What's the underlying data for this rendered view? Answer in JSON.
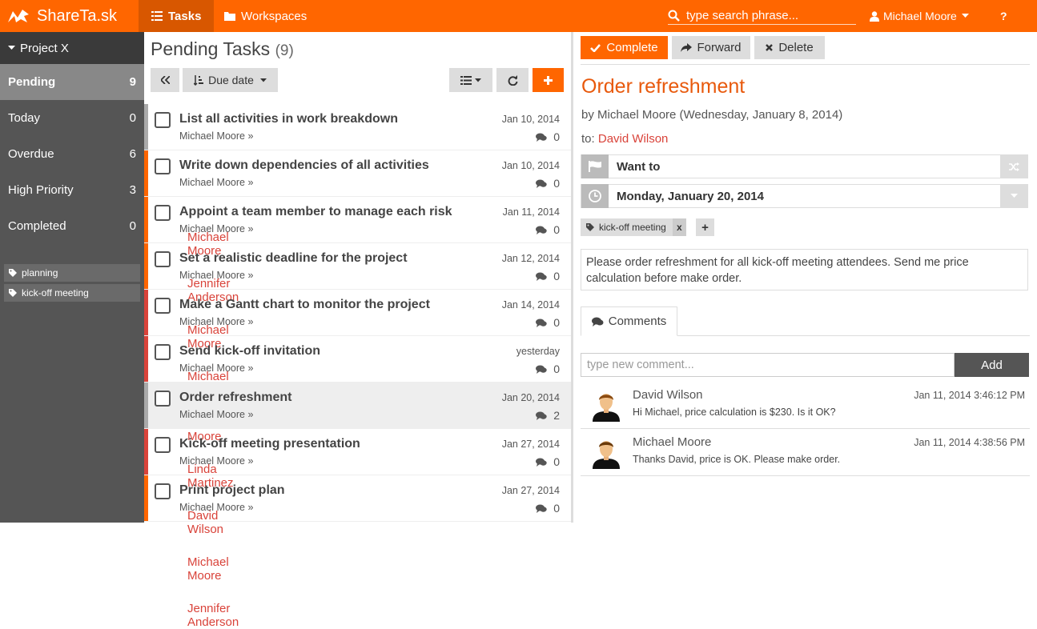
{
  "app": {
    "name": "ShareTa.sk"
  },
  "nav": {
    "tasks": "Tasks",
    "workspaces": "Workspaces"
  },
  "search": {
    "placeholder": "type search phrase..."
  },
  "user": {
    "name": "Michael Moore",
    "help": "?"
  },
  "sidebar": {
    "project": "Project X",
    "items": [
      {
        "label": "Pending",
        "count": "9"
      },
      {
        "label": "Today",
        "count": "0"
      },
      {
        "label": "Overdue",
        "count": "6"
      },
      {
        "label": "High Priority",
        "count": "3"
      },
      {
        "label": "Completed",
        "count": "0"
      }
    ],
    "tags": [
      "planning",
      "kick-off meeting"
    ]
  },
  "list": {
    "title": "Pending Tasks",
    "count": "(9)",
    "sort_label": "Due date",
    "tasks": [
      {
        "title": "List all activities in work breakdown",
        "from": "Michael Moore »",
        "to": "Michael Moore",
        "date": "Jan 10, 2014",
        "comments": "0",
        "color": "#aaaaaa"
      },
      {
        "title": "Write down dependencies of all activities",
        "from": "Michael Moore »",
        "to": "Jennifer Anderson",
        "date": "Jan 10, 2014",
        "comments": "0",
        "color": "#ff6600"
      },
      {
        "title": "Appoint a team member to manage each risk",
        "from": "Michael Moore »",
        "to": "Michael Moore",
        "date": "Jan 11, 2014",
        "comments": "0",
        "color": "#ff6600"
      },
      {
        "title": "Set a realistic deadline for the project",
        "from": "Michael Moore »",
        "to": "Michael Moore",
        "date": "Jan 12, 2014",
        "comments": "0",
        "color": "#ff6600"
      },
      {
        "title": "Make a Gantt chart to monitor the project",
        "from": "Michael Moore »",
        "to": "Michael Moore",
        "date": "Jan 14, 2014",
        "comments": "0",
        "color": "#d9433a"
      },
      {
        "title": "Send kick-off invitation",
        "from": "Michael Moore »",
        "to": "Linda Martinez",
        "date": "yesterday",
        "comments": "0",
        "color": "#d9433a"
      },
      {
        "title": "Order refreshment",
        "from": "Michael Moore »",
        "to": "David Wilson",
        "date": "Jan 20, 2014",
        "comments": "2",
        "color": "#aaaaaa"
      },
      {
        "title": "Kick-off meeting presentation",
        "from": "Michael Moore »",
        "to": "Michael Moore",
        "date": "Jan 27, 2014",
        "comments": "0",
        "color": "#d9433a"
      },
      {
        "title": "Print project plan",
        "from": "Michael Moore »",
        "to": "Jennifer Anderson",
        "date": "Jan 27, 2014",
        "comments": "0",
        "color": "#ff6600"
      }
    ]
  },
  "detail": {
    "buttons": {
      "complete": "Complete",
      "forward": "Forward",
      "delete": "Delete"
    },
    "title": "Order refreshment",
    "by": "by Michael Moore (Wednesday, January 8, 2014)",
    "to_label": "to:",
    "to_name": "David Wilson",
    "priority": "Want to",
    "due": "Monday, January 20, 2014",
    "tag": "kick-off meeting",
    "tag_remove": "x",
    "add_tag": "+",
    "description": "Please order refreshment for all kick-off meeting attendees. Send me price calculation before make order.",
    "comments_tab": "Comments",
    "comment_placeholder": "type new comment...",
    "add_label": "Add",
    "comments": [
      {
        "author": "David Wilson",
        "time": "Jan 11, 2014 3:46:12 PM",
        "text": "Hi Michael, price calculation is $230. Is it OK?"
      },
      {
        "author": "Michael Moore",
        "time": "Jan 11, 2014 4:38:56 PM",
        "text": "Thanks David, price is OK. Please make order."
      }
    ]
  },
  "colors": {
    "accent": "#ff6600",
    "dark": "#d85700",
    "assignee": "#d9433a",
    "overdue": "#d9433a",
    "neutral": "#aaaaaa"
  }
}
